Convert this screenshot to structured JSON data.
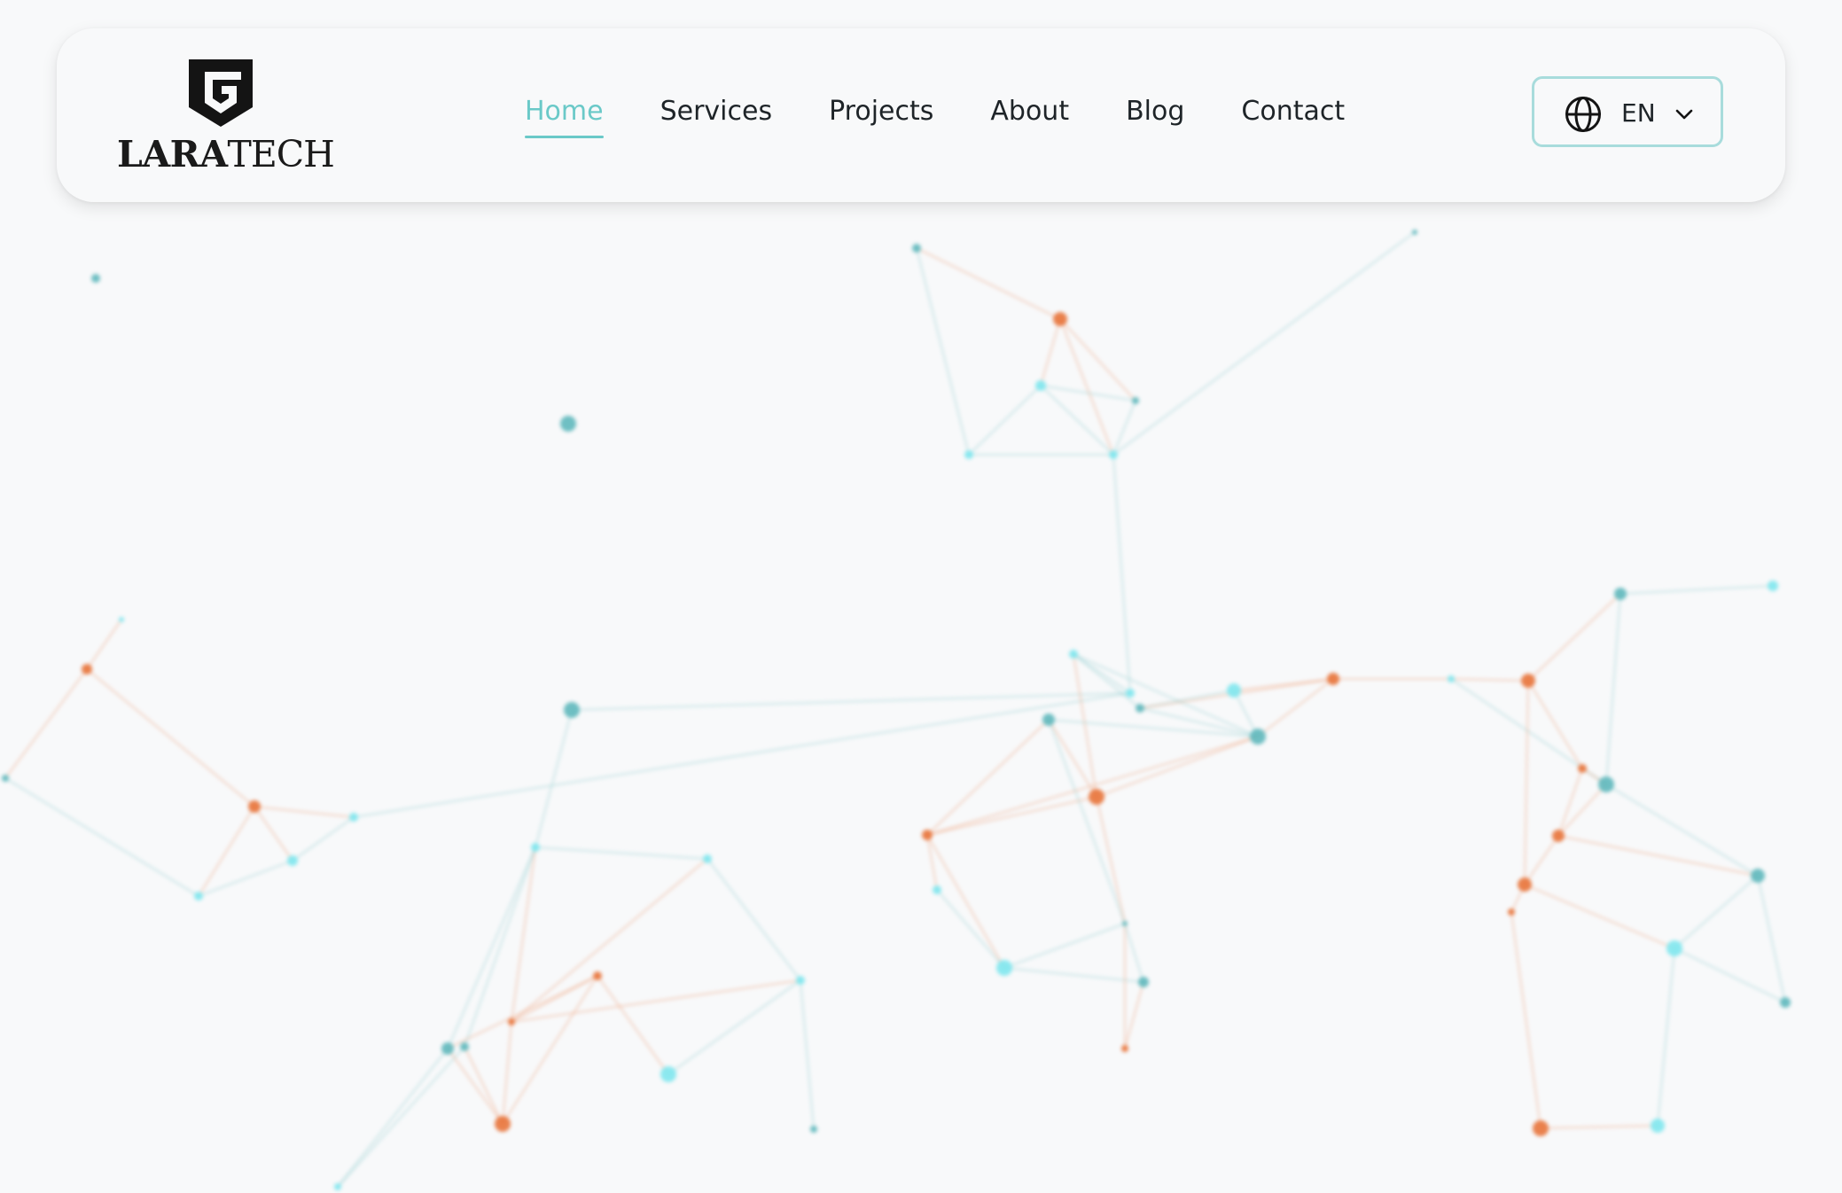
{
  "brand": {
    "logo_word_bold": "LARA",
    "logo_word_light": "TECH",
    "logo_icon": "shield-g-logo"
  },
  "nav": {
    "items": [
      {
        "label": "Home",
        "active": true
      },
      {
        "label": "Services",
        "active": false
      },
      {
        "label": "Projects",
        "active": false
      },
      {
        "label": "About",
        "active": false
      },
      {
        "label": "Blog",
        "active": false
      },
      {
        "label": "Contact",
        "active": false
      }
    ]
  },
  "language": {
    "label": "EN",
    "icon": "globe-icon",
    "dropdown_icon": "chevron-down-icon"
  },
  "colors": {
    "accent": "#6ac9c8",
    "accent_border": "#a8dcdc",
    "background": "#f8f9fa",
    "text": "#1e2428",
    "node_orange": "#e8743b",
    "node_teal": "#5fb8bc",
    "node_cyan": "#7fe7ee"
  }
}
